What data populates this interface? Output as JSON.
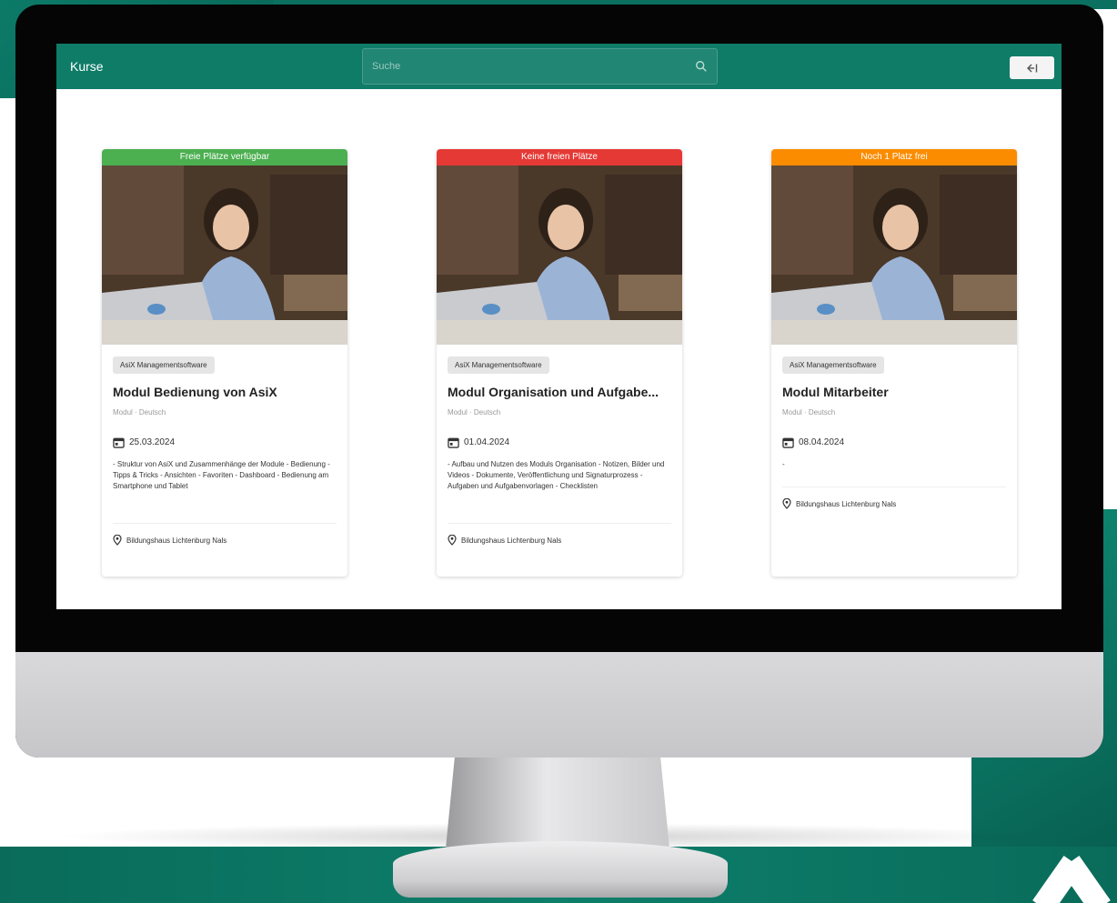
{
  "app": {
    "title": "Kurse",
    "search_placeholder": "Suche"
  },
  "icons": {
    "search": "search-icon",
    "logout": "logout-icon",
    "calendar": "calendar-icon",
    "location": "location-pin-icon"
  },
  "colors": {
    "appbar": "#0f7c68",
    "status_available": "#4caf50",
    "status_full": "#e53935",
    "status_few": "#fb8c00"
  },
  "courses": [
    {
      "status": "Freie Plätze verfügbar",
      "category": "AsiX Managementsoftware",
      "title": "Modul Bedienung von AsiX",
      "meta": "Modul · Deutsch",
      "date": "25.03.2024",
      "description": "- Struktur von AsiX und Zusammenhänge der Module - Bedienung - Tipps & Tricks - Ansichten - Favoriten - Dashboard - Bedienung am Smartphone und Tablet",
      "location": "Bildungshaus Lichtenburg Nals"
    },
    {
      "status": "Keine freien Plätze",
      "category": "AsiX Managementsoftware",
      "title": "Modul Organisation und Aufgabe...",
      "meta": "Modul · Deutsch",
      "date": "01.04.2024",
      "description": "- Aufbau und Nutzen des Moduls Organisation - Notizen, Bilder und Videos - Dokumente, Veröffentlichung und Signaturprozess - Aufgaben und Aufgabenvorlagen - Checklisten",
      "location": "Bildungshaus Lichtenburg Nals"
    },
    {
      "status": "Noch 1 Platz frei",
      "category": "AsiX Managementsoftware",
      "title": "Modul Mitarbeiter",
      "meta": "Modul · Deutsch",
      "date": "08.04.2024",
      "description": "-",
      "location": "Bildungshaus Lichtenburg Nals"
    }
  ]
}
